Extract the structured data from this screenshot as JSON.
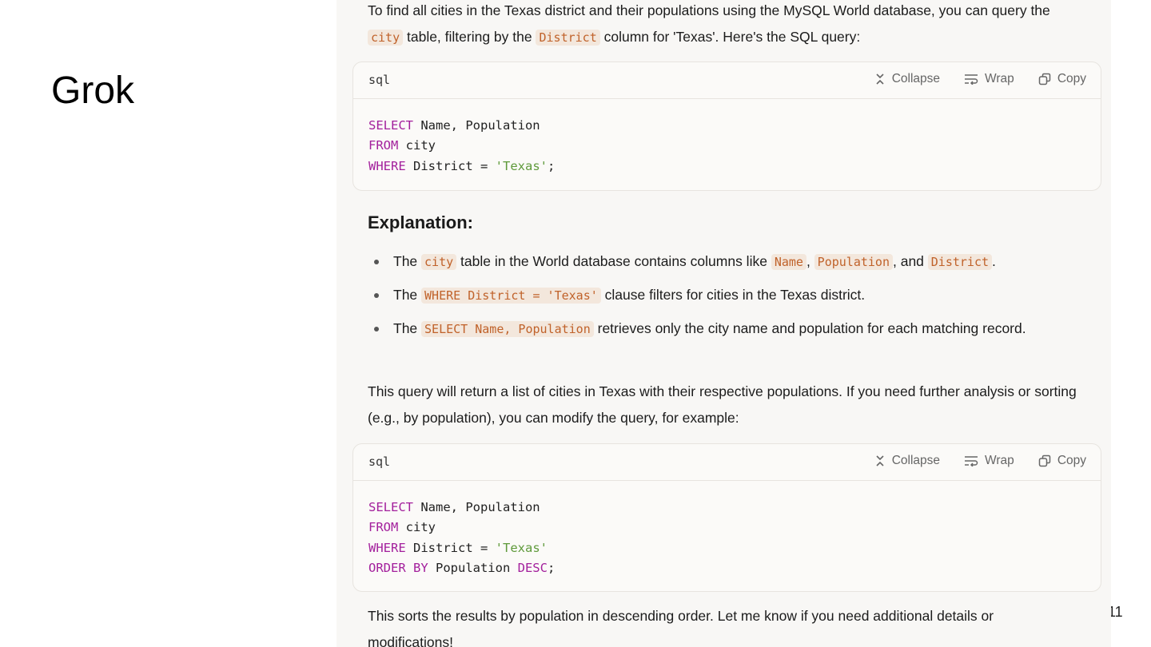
{
  "slide": {
    "title": "Grok",
    "page_number": "11"
  },
  "response": {
    "intro": {
      "t1": "To find all cities in the Texas district and their populations using the MySQL World database, you can query the ",
      "c1": "city",
      "t2": " table, filtering by the ",
      "c2": "District",
      "t3": " column for 'Texas'. Here's the SQL query:"
    },
    "code_toolbar": {
      "lang": "sql",
      "collapse": "Collapse",
      "wrap": "Wrap",
      "copy": "Copy"
    },
    "code1": [
      [
        {
          "k": "SELECT"
        },
        {
          "t": " Name, Population"
        }
      ],
      [
        {
          "k": "FROM"
        },
        {
          "t": " city"
        }
      ],
      [
        {
          "k": "WHERE"
        },
        {
          "t": " District = "
        },
        {
          "s": "'Texas'"
        },
        {
          "t": ";"
        }
      ]
    ],
    "explanation_heading": "Explanation:",
    "bullets": [
      {
        "t1": "The ",
        "c1": "city",
        "t2": " table in the World database contains columns like ",
        "c2": "Name",
        "t3": ", ",
        "c3": "Population",
        "t4": ", and ",
        "c4": "District",
        "t5": "."
      },
      {
        "t1": "The ",
        "c1": "WHERE District = 'Texas'",
        "t2": " clause filters for cities in the Texas district."
      },
      {
        "t1": "The ",
        "c1": "SELECT Name, Population",
        "t2": " retrieves only the city name and population for each matching record."
      }
    ],
    "para2": "This query will return a list of cities in Texas with their respective populations. If you need further analysis or sorting (e.g., by population), you can modify the query, for example:",
    "code2": [
      [
        {
          "k": "SELECT"
        },
        {
          "t": " Name, Population"
        }
      ],
      [
        {
          "k": "FROM"
        },
        {
          "t": " city"
        }
      ],
      [
        {
          "k": "WHERE"
        },
        {
          "t": " District = "
        },
        {
          "s": "'Texas'"
        }
      ],
      [
        {
          "k": "ORDER BY"
        },
        {
          "t": " Population "
        },
        {
          "k": "DESC"
        },
        {
          "t": ";"
        }
      ]
    ],
    "closing": "This sorts the results by population in descending order. Let me know if you need additional details or modifications!"
  }
}
